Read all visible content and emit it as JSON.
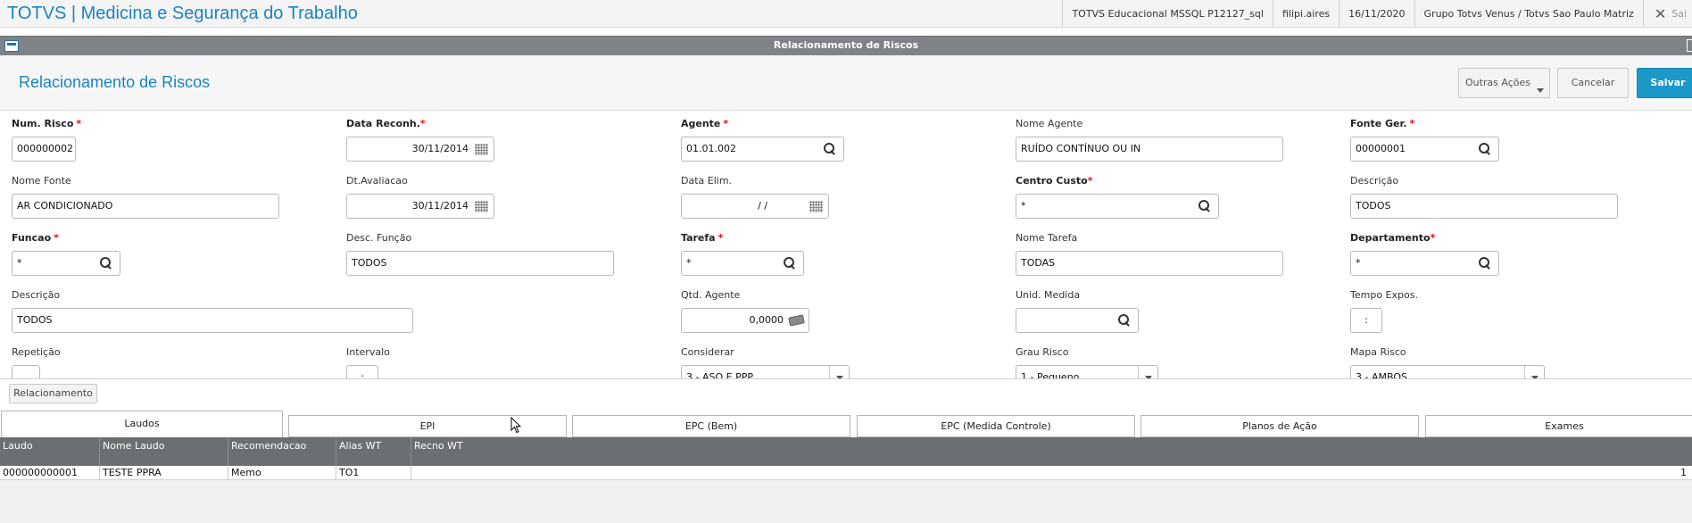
{
  "app": {
    "title": "TOTVS | Medicina e Segurança do Trabalho",
    "environment": "TOTVS Educacional MSSQL P12127_sql",
    "user": "filipi.aires",
    "date": "16/11/2020",
    "company": "Grupo Totvs Venus / Totvs Sao Paulo Matriz",
    "exit_label": "Sai"
  },
  "window": {
    "title": "Relacionamento de Riscos"
  },
  "header": {
    "title": "Relacionamento de Riscos",
    "outras_acoes": "Outras Ações",
    "cancelar": "Cancelar",
    "salvar": "Salvar"
  },
  "form": {
    "num_risco": {
      "label": "Num. Risco",
      "value": "000000002"
    },
    "data_reconh": {
      "label": "Data Reconh.",
      "value": "30/11/2014"
    },
    "agente": {
      "label": "Agente",
      "value": "01.01.002"
    },
    "nome_agente": {
      "label": "Nome Agente",
      "value": "RUÍDO CONTÍNUO OU IN"
    },
    "fonte_ger": {
      "label": "Fonte Ger.",
      "value": "00000001"
    },
    "nome_fonte": {
      "label": "Nome Fonte",
      "value": "AR CONDICIONADO"
    },
    "dt_avaliacao": {
      "label": "Dt.Avaliacao",
      "value": "30/11/2014"
    },
    "data_elim": {
      "label": "Data Elim.",
      "value": "/  /"
    },
    "centro_custo": {
      "label": "Centro Custo",
      "value": "*"
    },
    "descricao_cc": {
      "label": "Descrição",
      "value": "TODOS"
    },
    "funcao": {
      "label": "Funcao",
      "value": "*"
    },
    "desc_funcao": {
      "label": "Desc. Função",
      "value": "TODOS"
    },
    "tarefa": {
      "label": "Tarefa",
      "value": "*"
    },
    "nome_tarefa": {
      "label": "Nome Tarefa",
      "value": "TODAS"
    },
    "departamento": {
      "label": "Departamento",
      "value": "*"
    },
    "descricao_dep": {
      "label": "Descrição",
      "value": "TODOS"
    },
    "qtd_agente": {
      "label": "Qtd. Agente",
      "value": "0,0000"
    },
    "unid_medida": {
      "label": "Unid. Medida",
      "value": ""
    },
    "tempo_expos": {
      "label": "Tempo Expos.",
      "value": ":"
    },
    "repeticao": {
      "label": "Repetição",
      "value": ""
    },
    "intervalo": {
      "label": "Intervalo",
      "value": ":"
    },
    "considerar": {
      "label": "Considerar",
      "value": "3 - ASO E PPP"
    },
    "grau_risco": {
      "label": "Grau Risco",
      "value": "1 - Pequeno"
    },
    "mapa_risco": {
      "label": "Mapa Risco",
      "value": "3 - AMBOS"
    }
  },
  "relacionamento_button": "Relacionamento",
  "tabs": [
    "Laudos",
    "EPI",
    "EPC (Bem)",
    "EPC (Medida Controle)",
    "Planos de Ação",
    "Exames"
  ],
  "grid": {
    "columns": [
      "Laudo",
      "Nome Laudo",
      "Recomendacao",
      "Alias WT",
      "Recno WT"
    ],
    "rows": [
      [
        "000000000001",
        "TESTE PPRA",
        "Memo",
        "TO1",
        "1"
      ]
    ]
  }
}
